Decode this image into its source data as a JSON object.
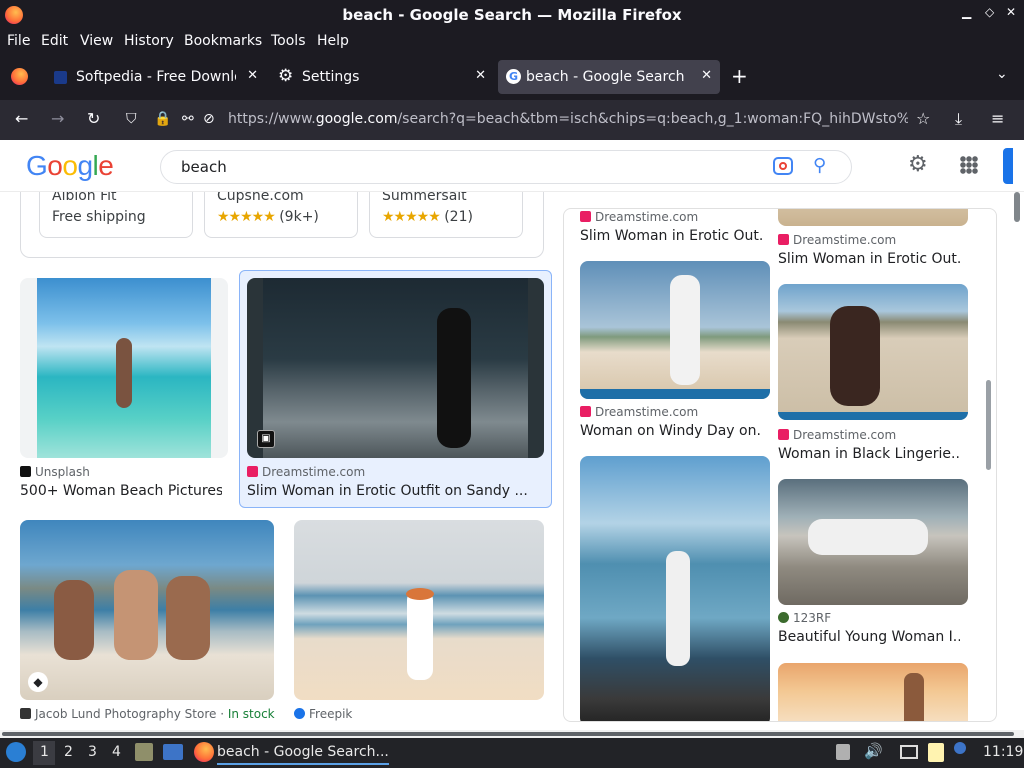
{
  "window": {
    "title": "beach - Google Search — Mozilla Firefox"
  },
  "menu": [
    "File",
    "Edit",
    "View",
    "History",
    "Bookmarks",
    "Tools",
    "Help"
  ],
  "tabs": [
    {
      "label": "Softpedia - Free Downloa"
    },
    {
      "label": "Settings"
    },
    {
      "label": "beach - Google Search",
      "active": true
    }
  ],
  "address": {
    "prefix": "https://www.",
    "domain": "google.com",
    "path": "/search?q=beach&tbm=isch&chips=q:beach,g_1:woman:FQ_hihDWsto%"
  },
  "search": {
    "query": "beach"
  },
  "logo": "Google",
  "shopping": [
    {
      "store": "Albion Fit",
      "line2": "Free shipping"
    },
    {
      "store": "Cupshe.com",
      "stars": "★★★★★",
      "reviews": "(9k+)"
    },
    {
      "store": "Summersalt",
      "stars": "★★★★★",
      "reviews": "(21)"
    }
  ],
  "results": [
    {
      "source": "Unsplash",
      "title": "500+ Woman Beach Pictures ..."
    },
    {
      "source": "Dreamstime.com",
      "title": "Slim Woman in Erotic Outfit on Sandy ..."
    },
    {
      "source": "Jacob Lund Photography Store",
      "badge": "In stock"
    },
    {
      "source": "Freepik"
    }
  ],
  "panel": {
    "left": [
      {
        "source": "Dreamstime.com",
        "title": "Slim Woman in Erotic Out..."
      },
      {
        "source": "Dreamstime.com",
        "title": "Woman on Windy Day on..."
      }
    ],
    "right": [
      {
        "source": "Dreamstime.com",
        "title": "Slim Woman in Erotic Out..."
      },
      {
        "source": "Dreamstime.com",
        "title": "Woman in Black Lingerie..."
      },
      {
        "source": "123RF",
        "title": "Beautiful Young Woman I..."
      }
    ]
  },
  "taskbar": {
    "workspaces": [
      "1",
      "2",
      "3",
      "4"
    ],
    "window": "beach - Google Search...",
    "clock": "11:19"
  },
  "colors": {
    "accent": "#1a73e8",
    "google_blue": "#4285f4",
    "google_red": "#ea4335",
    "google_yellow": "#fbbc05",
    "google_green": "#34a853",
    "selected_bg": "#e8f0fe"
  }
}
